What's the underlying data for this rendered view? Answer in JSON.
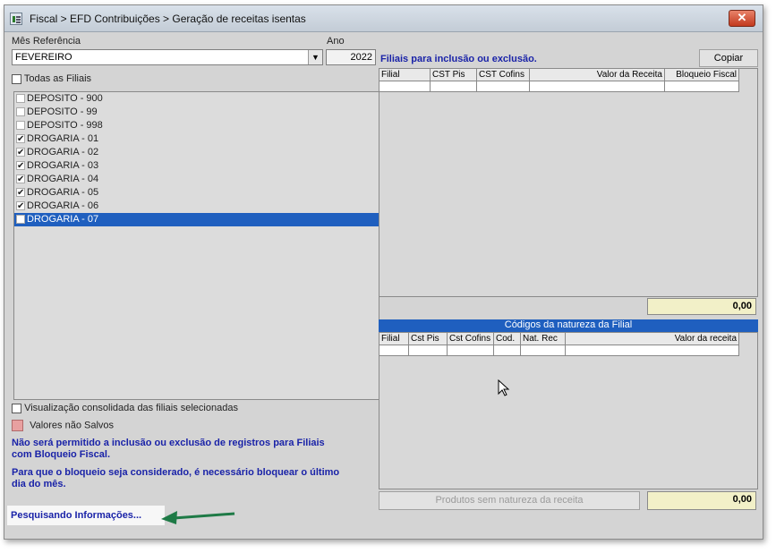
{
  "window": {
    "title": "Fiscal > EFD Contribuições > Geração de receitas isentas",
    "close_glyph": "✕"
  },
  "form": {
    "mes_label": "Mês Referência",
    "mes_value": "FEVEREIRO",
    "ano_label": "Ano",
    "ano_value": "2022",
    "todas_filiais_label": "Todas as Filiais"
  },
  "filiais_list": [
    {
      "label": "DEPOSITO - 900",
      "checked": false,
      "selected": false
    },
    {
      "label": "DEPOSITO - 99",
      "checked": false,
      "selected": false
    },
    {
      "label": "DEPOSITO - 998",
      "checked": false,
      "selected": false
    },
    {
      "label": "DROGARIA - 01",
      "checked": true,
      "selected": false
    },
    {
      "label": "DROGARIA - 02",
      "checked": true,
      "selected": false
    },
    {
      "label": "DROGARIA - 03",
      "checked": true,
      "selected": false
    },
    {
      "label": "DROGARIA - 04",
      "checked": true,
      "selected": false
    },
    {
      "label": "DROGARIA - 05",
      "checked": true,
      "selected": false
    },
    {
      "label": "DROGARIA - 06",
      "checked": true,
      "selected": false
    },
    {
      "label": "DROGARIA - 07",
      "checked": true,
      "selected": true
    }
  ],
  "options": {
    "visualizacao_label": "Visualização consolidada das filiais selecionadas",
    "valores_nao_salvos_label": "Valores não Salvos",
    "aviso1": "Não será permitido a inclusão ou exclusão de registros para Filiais com Bloqueio Fiscal.",
    "aviso2": "Para que o bloqueio seja considerado, é necessário bloquear o último dia do mês."
  },
  "grid_filiais": {
    "title": "Filiais para inclusão ou exclusão.",
    "copy_label": "Copiar",
    "columns": [
      "Filial",
      "CST Pis",
      "CST Cofins",
      "Valor da Receita",
      "Bloqueio Fiscal"
    ],
    "total": "0,00"
  },
  "grid_natureza": {
    "title": "Códigos da natureza  da Filial",
    "columns": [
      "Filial",
      "Cst Pis",
      "Cst Cofins",
      "Cod.",
      "Nat. Rec",
      "Valor da receita"
    ],
    "produtos_label": "Produtos sem natureza  da receita",
    "total": "0,00"
  },
  "status": {
    "text": "Pesquisando Informações..."
  },
  "colors": {
    "selection": "#1f5fbf",
    "info_text": "#1a23a8",
    "total_bg": "#f2f0c8",
    "arrow": "#1e7a46"
  }
}
